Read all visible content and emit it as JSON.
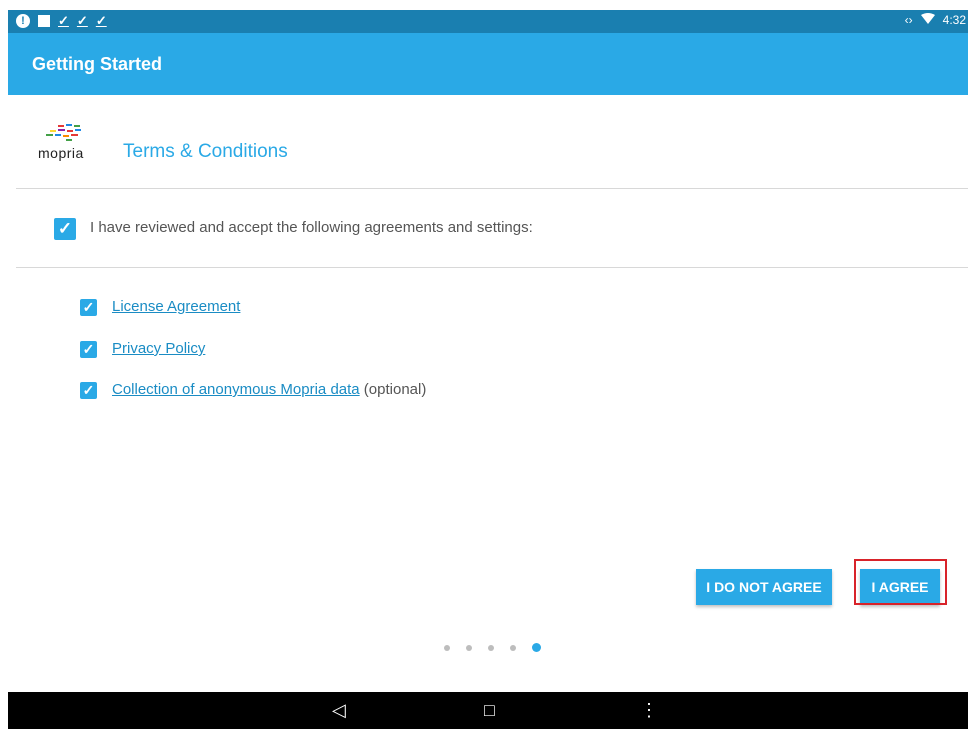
{
  "status_bar": {
    "left_icons": [
      "alert-icon",
      "square-icon",
      "check-icon",
      "check-icon",
      "check-icon"
    ],
    "right_icons": [
      "data-arrows-icon",
      "wifi-icon"
    ],
    "time": "4:32"
  },
  "app_bar": {
    "title": "Getting Started"
  },
  "header": {
    "logo_text": "mopria",
    "title": "Terms & Conditions"
  },
  "accept_all": {
    "checked": true,
    "label": "I have reviewed and accept the following agreements and settings:"
  },
  "agreements": [
    {
      "label": "License Agreement",
      "suffix": "",
      "checked": true
    },
    {
      "label": "Privacy Policy",
      "suffix": "",
      "checked": true
    },
    {
      "label": "Collection of anonymous Mopria data",
      "suffix": " (optional)",
      "checked": true
    }
  ],
  "buttons": {
    "disagree": "I DO NOT AGREE",
    "agree": "I AGREE"
  },
  "pager": {
    "count": 5,
    "active_index": 4
  },
  "nav_bar": {
    "back": "◁",
    "home": "□",
    "menu": "⋮"
  },
  "colors": {
    "status_bar": "#1a7fb0",
    "accent": "#2aa9e6",
    "highlight": "#d8232a"
  }
}
